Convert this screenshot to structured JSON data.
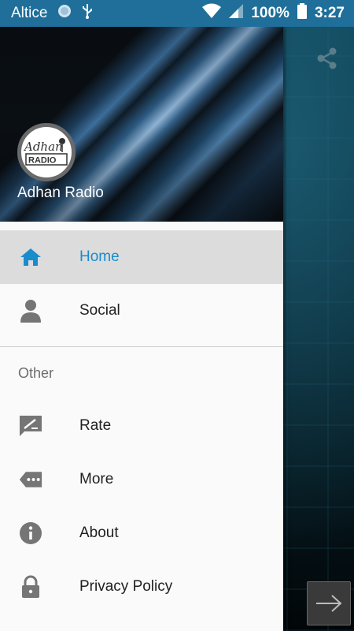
{
  "status_bar": {
    "carrier": "Altice",
    "battery": "100%",
    "time": "3:27"
  },
  "drawer": {
    "header": {
      "logo_text_top": "Adhan",
      "logo_text_bottom": "RADIO",
      "title": "Adhan Radio"
    },
    "primary_items": [
      {
        "label": "Home",
        "icon": "home-icon",
        "active": true
      },
      {
        "label": "Social",
        "icon": "person-icon",
        "active": false
      }
    ],
    "section_label": "Other",
    "secondary_items": [
      {
        "label": "Rate",
        "icon": "rate-review-icon"
      },
      {
        "label": "More",
        "icon": "more-tag-icon"
      },
      {
        "label": "About",
        "icon": "info-icon"
      },
      {
        "label": "Privacy Policy",
        "icon": "lock-icon"
      }
    ]
  },
  "colors": {
    "status_bar": "#1f6f9a",
    "active_accent": "#1a8ccc",
    "icon_grey": "#757575"
  }
}
